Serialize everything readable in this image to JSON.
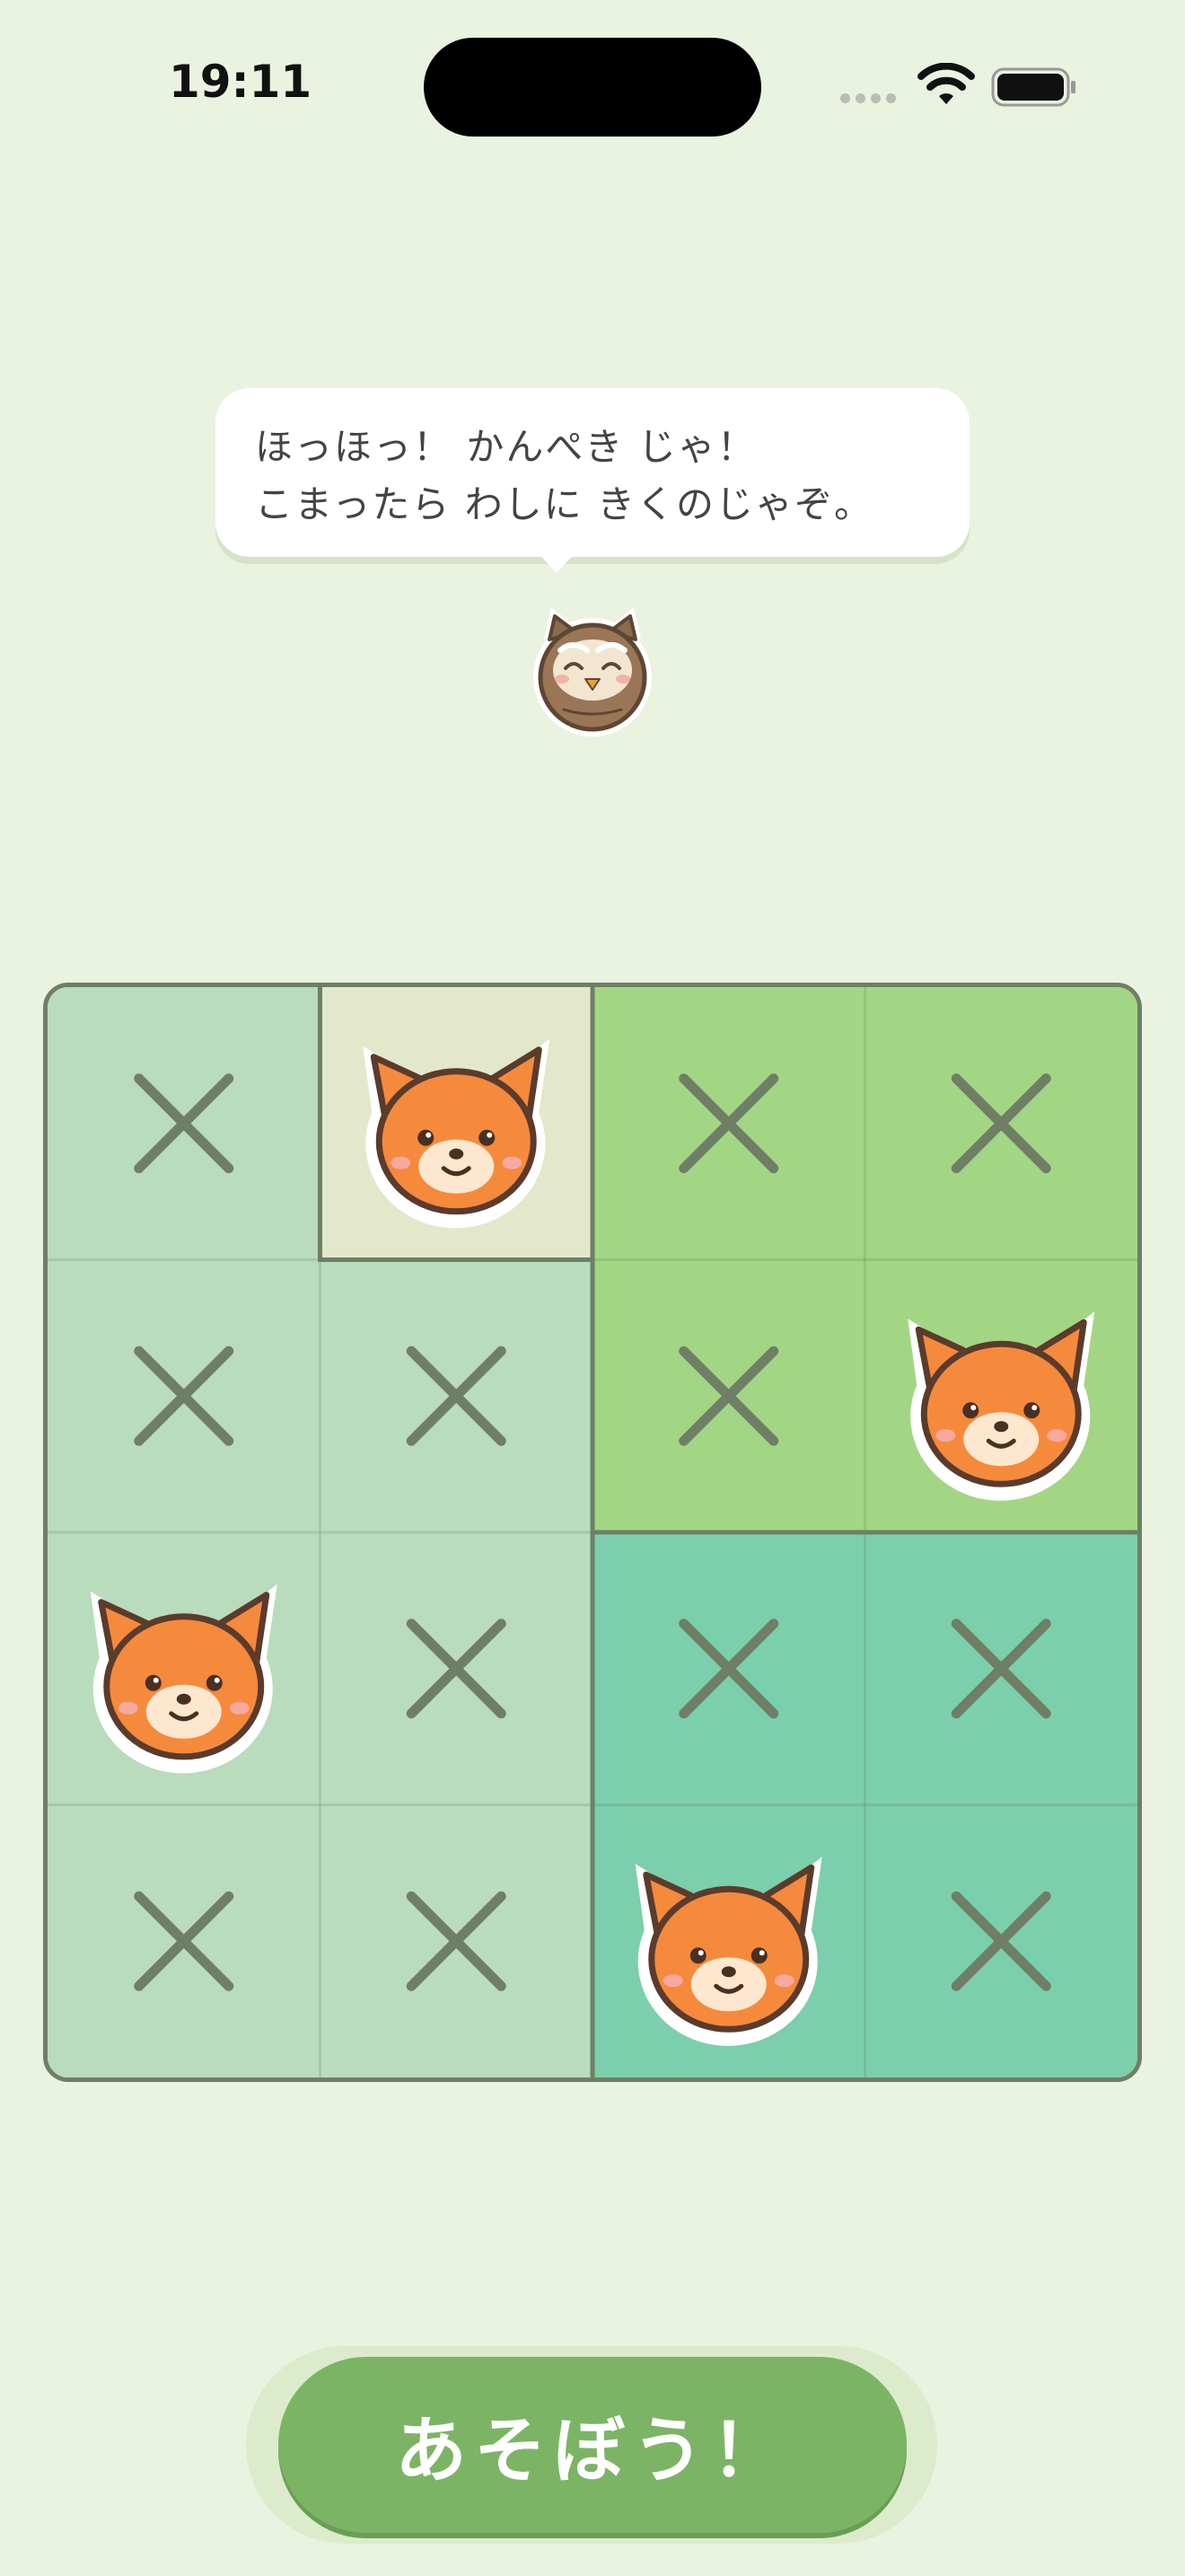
{
  "status_bar": {
    "time": "19:11",
    "wifi_icon": "wifi-icon",
    "battery_icon": "battery-icon"
  },
  "speech": {
    "line1": "ほっほっ！ かんぺき じゃ！",
    "line2": "こまったら わしに きくのじゃぞ。"
  },
  "mascot": "owl-icon",
  "board": {
    "rows": 4,
    "cols": 4,
    "cells": [
      [
        "cross",
        "fox",
        "cross",
        "cross"
      ],
      [
        "cross",
        "cross",
        "cross",
        "fox"
      ],
      [
        "fox",
        "cross",
        "cross",
        "cross"
      ],
      [
        "cross",
        "cross",
        "fox",
        "cross"
      ]
    ],
    "regions": [
      [
        "A",
        "B",
        "C",
        "C"
      ],
      [
        "A",
        "A",
        "C",
        "C"
      ],
      [
        "A",
        "A",
        "D",
        "D"
      ],
      [
        "A",
        "A",
        "D",
        "D"
      ]
    ],
    "region_colors": {
      "A": "#b8dcbc",
      "B": "#e3e8cb",
      "C": "#a3d684",
      "D": "#7ccfac"
    },
    "cross_icon": "cross-icon",
    "fox_icon": "fox-icon"
  },
  "play_button": {
    "label": "あそぼう！"
  },
  "colors": {
    "background": "#eaf2e0",
    "button": "#7cb465"
  }
}
